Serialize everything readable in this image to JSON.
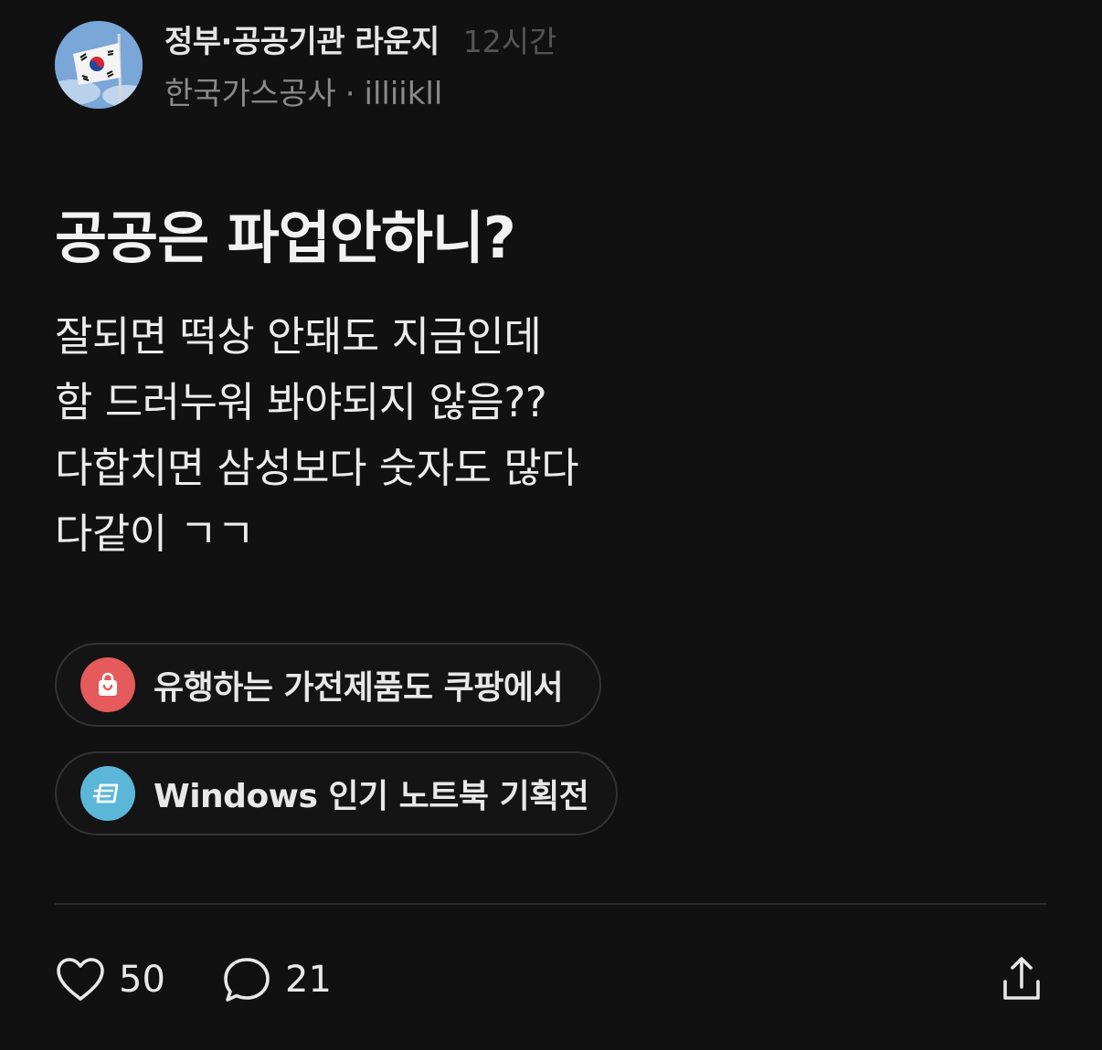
{
  "header": {
    "channel_name": "정부·공공기관 라운지",
    "timestamp": "12시간",
    "company": "한국가스공사",
    "separator": "·",
    "username": "illiikll"
  },
  "post": {
    "title": "공공은 파업안하니?",
    "body_lines": [
      "잘되면 떡상 안돼도 지금인데",
      "함 드러누워 봐야되지 않음??",
      "다합치면 삼성보다 숫자도 많다",
      "다같이 ㄱㄱ"
    ]
  },
  "promos": [
    {
      "label": "유행하는 가전제품도 쿠팡에서",
      "icon": "shopping-bag-icon",
      "color": "#e55a5a"
    },
    {
      "label": "Windows 인기 노트북 기획전",
      "icon": "event-ticket-icon",
      "color": "#5bb6d8"
    }
  ],
  "actions": {
    "likes": "50",
    "comments": "21",
    "like_icon": "heart-icon",
    "comment_icon": "speech-bubble-icon",
    "share_icon": "share-icon"
  },
  "colors": {
    "background": "#111111",
    "text_primary": "#ececec",
    "text_secondary": "#8a8a8a",
    "text_muted": "#555555"
  }
}
